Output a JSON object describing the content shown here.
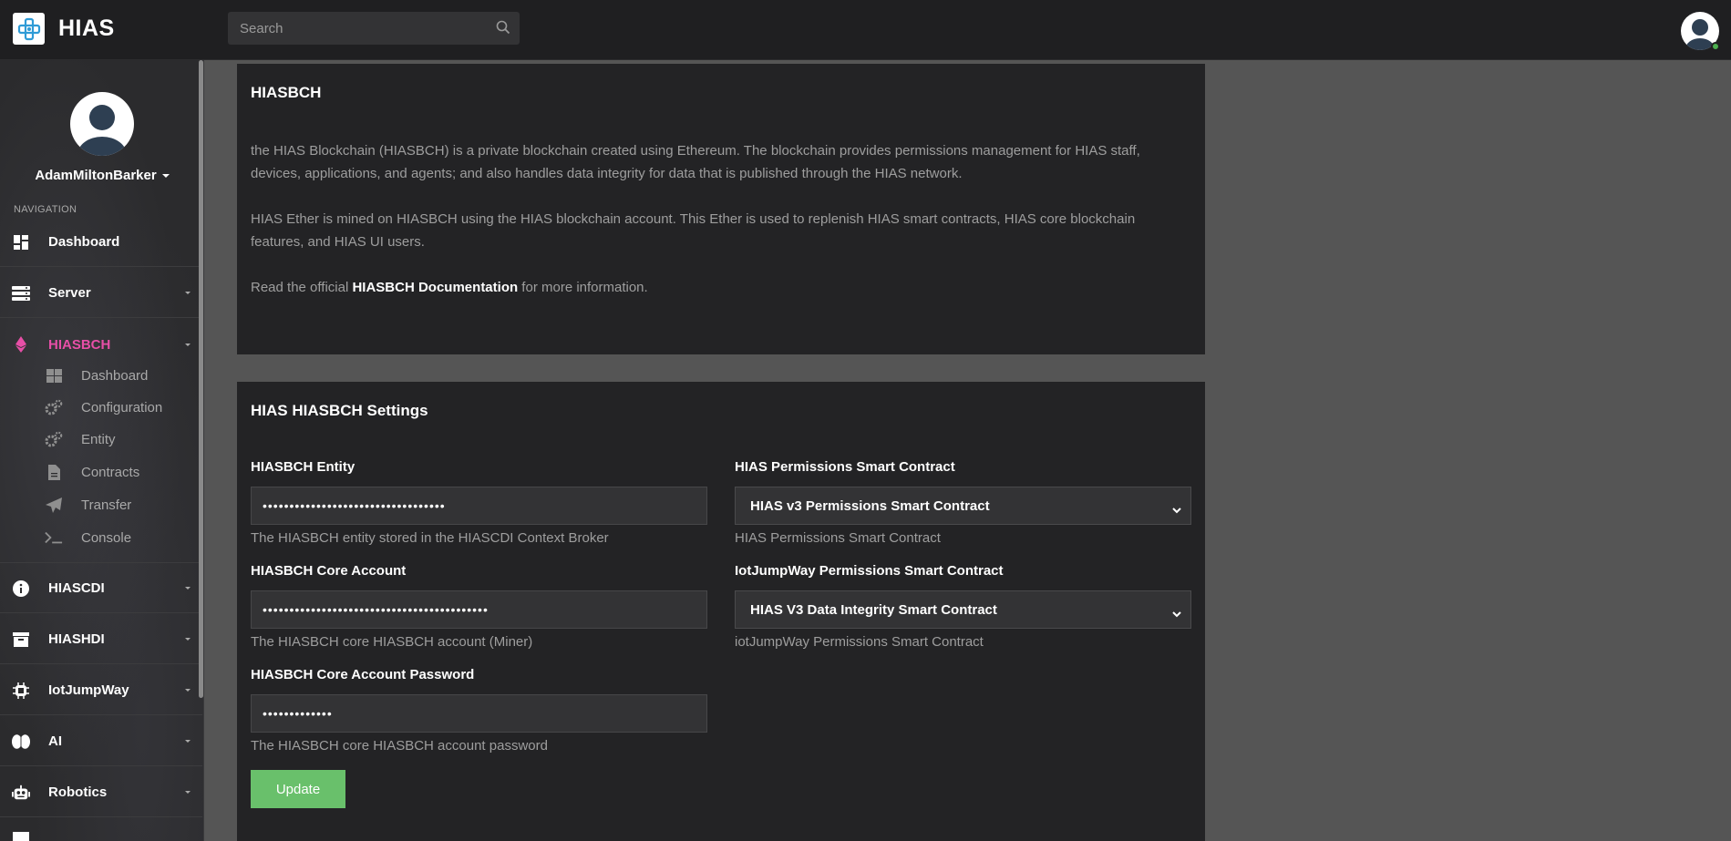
{
  "app": {
    "name": "HIAS"
  },
  "search": {
    "placeholder": "Search"
  },
  "user": {
    "name": "AdamMiltonBarker"
  },
  "sidebar": {
    "heading": "NAVIGATION",
    "items": [
      {
        "label": "Dashboard",
        "icon": "dashboard-icon"
      },
      {
        "label": "Server",
        "icon": "server-icon"
      },
      {
        "label": "HIASBCH",
        "icon": "ethereum-icon",
        "active": true
      },
      {
        "label": "HIASCDI",
        "icon": "info-icon"
      },
      {
        "label": "HIASHDI",
        "icon": "archive-icon"
      },
      {
        "label": "IotJumpWay",
        "icon": "chip-icon"
      },
      {
        "label": "AI",
        "icon": "brain-icon"
      },
      {
        "label": "Robotics",
        "icon": "robot-icon"
      }
    ],
    "subitems": [
      {
        "label": "Dashboard",
        "icon": "grid-icon"
      },
      {
        "label": "Configuration",
        "icon": "cogs-icon"
      },
      {
        "label": "Entity",
        "icon": "cogs-icon"
      },
      {
        "label": "Contracts",
        "icon": "file-icon"
      },
      {
        "label": "Transfer",
        "icon": "paper-plane-icon"
      },
      {
        "label": "Console",
        "icon": "terminal-icon"
      }
    ]
  },
  "info_card": {
    "title": "HIASBCH",
    "para1": "the HIAS Blockchain (HIASBCH) is a private blockchain created using Ethereum. The blockchain provides permissions management for HIAS staff, devices, applications, and agents; and also handles data integrity for data that is published through the HIAS network.",
    "para2": "HIAS Ether is mined on HIASBCH using the HIAS blockchain account. This Ether is used to replenish HIAS smart contracts, HIAS core blockchain features, and HIAS UI users.",
    "para3_prefix": "Read the official ",
    "para3_link": "HIASBCH Documentation",
    "para3_suffix": " for more information."
  },
  "settings_card": {
    "title": "HIAS HIASBCH Settings",
    "entity": {
      "label": "HIASBCH Entity",
      "value": "••••••••••••••••••••••••••••••••••",
      "help": "The HIASBCH entity stored in the HIASCDI Context Broker"
    },
    "core_account": {
      "label": "HIASBCH Core Account",
      "value": "••••••••••••••••••••••••••••••••••••••••••",
      "help": "The HIASBCH core HIASBCH account (Miner)"
    },
    "core_password": {
      "label": "HIASBCH Core Account Password",
      "value": "•••••••••••••",
      "help": "The HIASBCH core HIASBCH account password"
    },
    "permissions_contract": {
      "label": "HIAS Permissions Smart Contract",
      "selected": "HIAS v3 Permissions Smart Contract",
      "help": "HIAS Permissions Smart Contract"
    },
    "iot_contract": {
      "label": "IotJumpWay Permissions Smart Contract",
      "selected": "HIAS V3 Data Integrity Smart Contract",
      "help": "iotJumpWay Permissions Smart Contract"
    },
    "update_label": "Update"
  },
  "colors": {
    "accent": "#e74fa7",
    "success": "#69c06b",
    "card": "#232325",
    "topbar": "#1f1f21"
  }
}
